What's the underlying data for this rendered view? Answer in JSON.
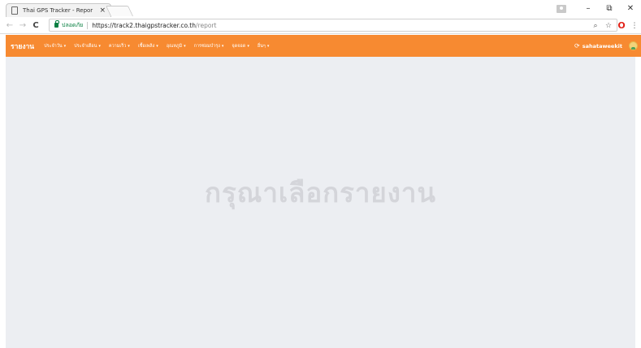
{
  "browser": {
    "tab_title": "Thai GPS Tracker - Repor",
    "tab_close": "×",
    "window_controls": {
      "minimize": "–",
      "maximize": "⧉",
      "close": "✕"
    },
    "nav": {
      "back": "←",
      "forward": "→",
      "reload": "C"
    },
    "security_label": "ปลอดภัย",
    "url": {
      "host": "https://track2.thaigpstracker.co.th",
      "path": "/report"
    },
    "right_icons": {
      "zoom": "⌕",
      "bookmark": "☆",
      "opera": "O",
      "menu": "⋮"
    }
  },
  "navbar": {
    "brand": "รายงาน",
    "caret": "▾",
    "menu": [
      {
        "label": "ประจำวัน"
      },
      {
        "label": "ประจำเดือน"
      },
      {
        "label": "ความเร็ว"
      },
      {
        "label": "เชื้อเพลิง"
      },
      {
        "label": "อุณหภูมิ"
      },
      {
        "label": "การซ่อมบำรุง"
      },
      {
        "label": "จุดจอด"
      },
      {
        "label": "อื่นๆ"
      }
    ],
    "logout_icon": "⟳",
    "username": "sahataweekit"
  },
  "content": {
    "placeholder": "กรุณาเลือกรายงาน"
  },
  "colors": {
    "accent": "#f78a31",
    "content_bg": "#eceef2",
    "placeholder_text": "#d4d5da"
  }
}
